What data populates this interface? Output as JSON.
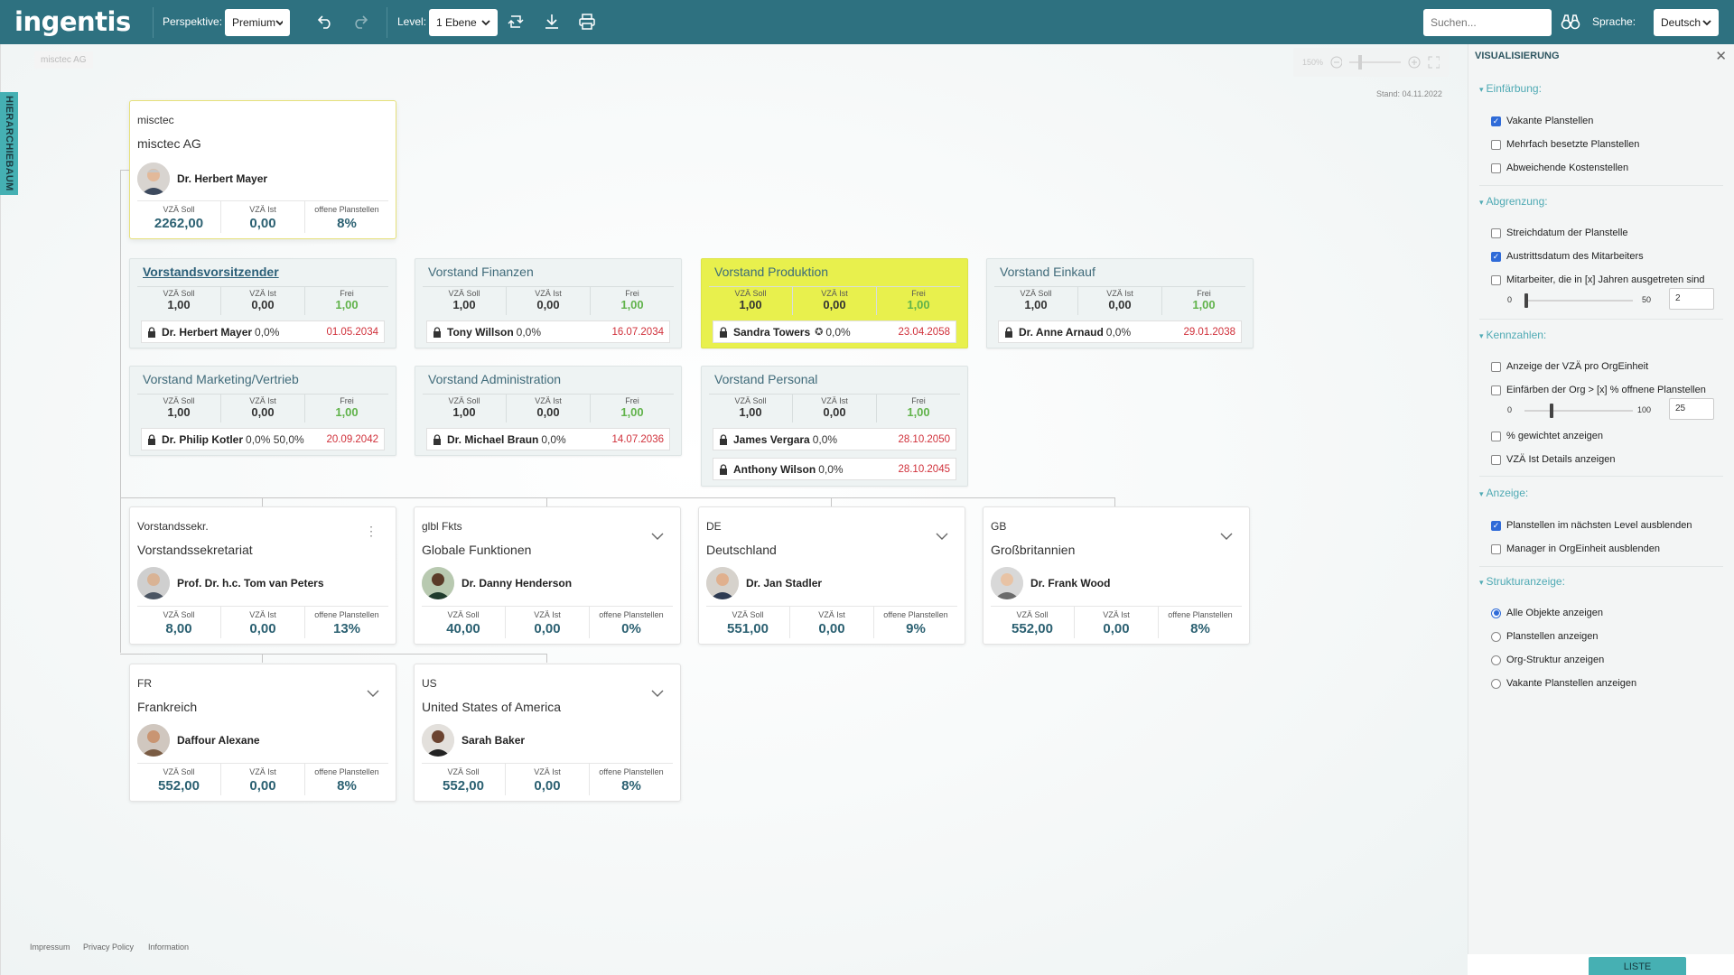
{
  "header": {
    "logo": "ingentis",
    "perspektive_label": "Perspektive:",
    "perspektive_value": "Premium",
    "level_label": "Level:",
    "level_value": "1 Ebene",
    "search_placeholder": "Suchen...",
    "sprache_label": "Sprache:",
    "sprache_value": "Deutsch",
    "icons": [
      "undo-icon",
      "redo-icon",
      "refresh-icon",
      "download-icon",
      "print-icon",
      "binoculars-icon"
    ]
  },
  "canvas": {
    "breadcrumb": "misctec AG",
    "side_tab": "HIERARCHIEBAUM",
    "zoom_value": "150%",
    "stand": "Stand: 04.11.2022"
  },
  "root": {
    "code": "misctec",
    "name": "misctec AG",
    "person": "Dr. Herbert Mayer",
    "stats": [
      {
        "label": "VZÄ Soll",
        "value": "2262,00"
      },
      {
        "label": "VZÄ Ist",
        "value": "0,00"
      },
      {
        "label": "offene Planstellen",
        "value": "8%"
      }
    ]
  },
  "vorstand": [
    {
      "title": "Vorstandsvorsitzender",
      "soll": "1,00",
      "ist": "0,00",
      "frei": "1,00",
      "persons": [
        {
          "name": "Dr. Herbert Mayer",
          "pct": "0,0%",
          "date": "01.05.2034"
        }
      ]
    },
    {
      "title": "Vorstand Finanzen",
      "soll": "1,00",
      "ist": "0,00",
      "frei": "1,00",
      "persons": [
        {
          "name": "Tony Willson",
          "pct": "0,0%",
          "date": "16.07.2034"
        }
      ]
    },
    {
      "title": "Vorstand Produktion",
      "soll": "1,00",
      "ist": "0,00",
      "frei": "1,00",
      "persons": [
        {
          "name": "Sandra Towers",
          "pct": "0,0%",
          "date": "23.04.2058"
        }
      ]
    },
    {
      "title": "Vorstand Einkauf",
      "soll": "1,00",
      "ist": "0,00",
      "frei": "1,00",
      "persons": [
        {
          "name": "Dr. Anne Arnaud",
          "pct": "0,0%",
          "date": "29.01.2038"
        }
      ]
    },
    {
      "title": "Vorstand Marketing/Vertrieb",
      "soll": "1,00",
      "ist": "0,00",
      "frei": "1,00",
      "persons": [
        {
          "name": "Dr. Philip Kotler",
          "pct": "0,0% 50,0%",
          "date": "20.09.2042"
        }
      ]
    },
    {
      "title": "Vorstand Administration",
      "soll": "1,00",
      "ist": "0,00",
      "frei": "1,00",
      "persons": [
        {
          "name": "Dr. Michael Braun",
          "pct": "0,0%",
          "date": "14.07.2036"
        }
      ]
    },
    {
      "title": "Vorstand Personal",
      "soll": "1,00",
      "ist": "0,00",
      "frei": "1,00",
      "persons": [
        {
          "name": "James Vergara",
          "pct": "0,0%",
          "date": "28.10.2050"
        },
        {
          "name": "Anthony Wilson",
          "pct": "0,0%",
          "date": "28.10.2045"
        }
      ]
    }
  ],
  "labels": {
    "vza_soll": "VZÄ Soll",
    "vza_ist": "VZÄ Ist",
    "frei": "Frei",
    "offene": "offene Planstellen"
  },
  "units": [
    {
      "code": "Vorstandssekr.",
      "name": "Vorstandssekretariat",
      "person": "Prof. Dr. h.c. Tom van Peters",
      "soll": "8,00",
      "ist": "0,00",
      "offen": "13%"
    },
    {
      "code": "glbl Fkts",
      "name": "Globale Funktionen",
      "person": "Dr. Danny Henderson",
      "soll": "40,00",
      "ist": "0,00",
      "offen": "0%"
    },
    {
      "code": "DE",
      "name": "Deutschland",
      "person": "Dr. Jan Stadler",
      "soll": "551,00",
      "ist": "0,00",
      "offen": "9%"
    },
    {
      "code": "GB",
      "name": "Großbritannien",
      "person": "Dr. Frank Wood",
      "soll": "552,00",
      "ist": "0,00",
      "offen": "8%"
    },
    {
      "code": "FR",
      "name": "Frankreich",
      "person": "Daffour Alexane",
      "soll": "552,00",
      "ist": "0,00",
      "offen": "8%"
    },
    {
      "code": "US",
      "name": "United States of America",
      "person": "Sarah Baker",
      "soll": "552,00",
      "ist": "0,00",
      "offen": "8%"
    }
  ],
  "footer": [
    "Impressum",
    "Privacy Policy",
    "Information"
  ],
  "panel": {
    "title": "VISUALISIERUNG",
    "sections": {
      "einfaerbung": "Einfärbung:",
      "abgrenzung": "Abgrenzung:",
      "kennzahlen": "Kennzahlen:",
      "anzeige": "Anzeige:",
      "struktur": "Strukturanzeige:"
    },
    "options": {
      "vakante": "Vakante Planstellen",
      "mehrfach": "Mehrfach besetzte Planstellen",
      "abweichende": "Abweichende Kostenstellen",
      "streich": "Streichdatum der Planstelle",
      "austritt": "Austrittsdatum des Mitarbeiters",
      "mitarbeiter_jahre": "Mitarbeiter, die in [x] Jahren ausgetreten sind",
      "anzeige_vza": "Anzeige der VZÄ pro OrgEinheit",
      "einfaerben_org": "Einfärben der Org > [x] % offnene Planstellen",
      "gewichtet": "% gewichtet anzeigen",
      "vza_details": "VZÄ Ist Details anzeigen",
      "planstellen_naechster": "Planstellen im nächsten Level ausblenden",
      "manager_ausblenden": "Manager in OrgEinheit ausblenden",
      "alle_objekte": "Alle Objekte anzeigen",
      "planstellen_anzeigen": "Planstellen anzeigen",
      "org_struktur": "Org-Struktur anzeigen",
      "vakante_anzeigen": "Vakante Planstellen anzeigen"
    },
    "slider1": {
      "min": "0",
      "max": "50",
      "value": "2",
      "level": 0.04
    },
    "slider2": {
      "min": "0",
      "max": "100",
      "value": "25",
      "level": 0.25
    },
    "liste_button": "LISTE"
  }
}
